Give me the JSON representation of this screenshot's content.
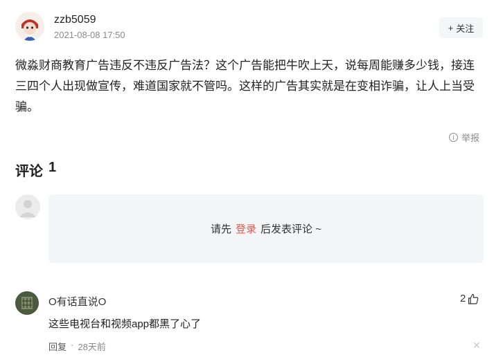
{
  "post": {
    "username": "zzb5059",
    "time": "2021-08-08 17:50",
    "follow_label": "关注",
    "body": "微淼财商教育广告违反不违反广告法？这个广告能把牛吹上天，说每周能赚多少钱，接连三四个人出现做宣传，难道国家就不管吗。这样的广告其实就是在变相诈骗，让人上当受骗。",
    "report_label": "举报"
  },
  "comments_section": {
    "title": "评论",
    "count": "1",
    "prompt_before": "请先",
    "login_label": "登录",
    "prompt_after": "后发表评论 ~"
  },
  "comments": [
    {
      "author": "O有话直说O",
      "likes": "2",
      "text": "这些电视台和视频app都黑了心了",
      "reply_label": "回复",
      "dot": "·",
      "time": "28天前"
    }
  ],
  "icons": {
    "follow": "plus-icon",
    "report": "info-circle-icon",
    "like": "thumbs-up-icon",
    "close": "close-icon"
  }
}
